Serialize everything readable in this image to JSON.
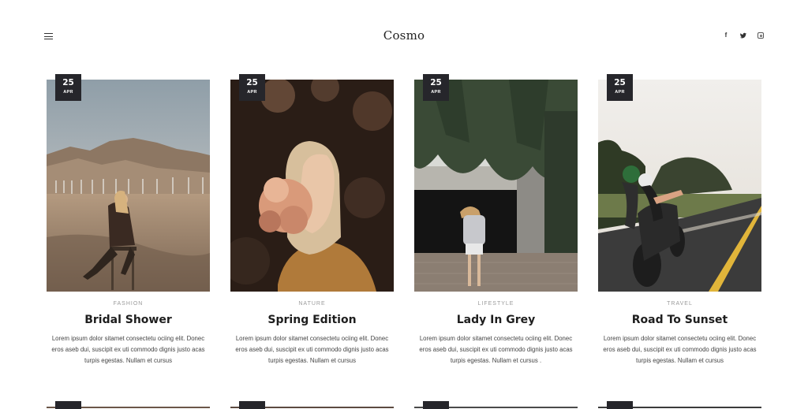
{
  "header": {
    "brand": "Cosmo",
    "social": [
      {
        "icon": "facebook-icon",
        "glyph": "f"
      },
      {
        "icon": "twitter-icon",
        "glyph": "t"
      },
      {
        "icon": "instagram-icon",
        "glyph": ""
      }
    ]
  },
  "posts": [
    {
      "day": "25",
      "month": "APR",
      "category": "FASHION",
      "title": "Bridal Shower",
      "excerpt": "Lorem ipsum dolor sitamet consectetu ociing elit. Donec eros aseb dui, suscipit ex uti commodo dignis justo acas turpis egestas. Nullam et cursus"
    },
    {
      "day": "25",
      "month": "APR",
      "category": "NATURE",
      "title": "Spring Edition",
      "excerpt": "Lorem ipsum dolor sitamet consectetu ociing elit. Donec eros aseb dui, suscipit ex uti commodo dignis justo acas turpis egestas. Nullam et cursus"
    },
    {
      "day": "25",
      "month": "APR",
      "category": "LIFESTYLE",
      "title": "Lady In Grey",
      "excerpt": "Lorem ipsum dolor sitamet consectetu ociing elit. Donec eros aseb dui, suscipit ex uti commodo dignis justo acas turpis egestas. Nullam et cursus ."
    },
    {
      "day": "25",
      "month": "APR",
      "category": "TRAVEL",
      "title": "Road To Sunset",
      "excerpt": "Lorem ipsum dolor sitamet consectetu ociing elit. Donec eros aseb dui, suscipit ex uti commodo dignis justo acas turpis egestas. Nullam et cursus"
    }
  ]
}
